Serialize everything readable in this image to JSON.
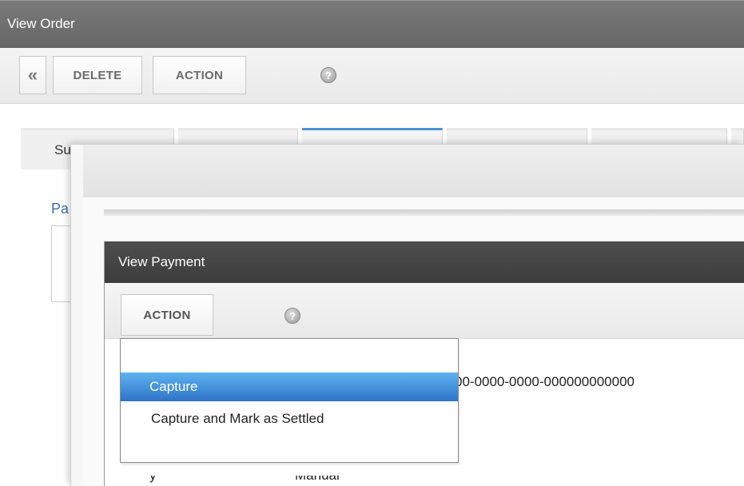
{
  "window": {
    "title": "View Order"
  },
  "toolbar": {
    "back_glyph": "«",
    "delete_label": "DELETE",
    "action_label": "ACTION",
    "help_glyph": "?"
  },
  "tabs": [
    {
      "label": "Su"
    },
    {
      "label": ""
    },
    {
      "label": ""
    },
    {
      "label": ""
    },
    {
      "label": ""
    },
    {
      "label": ""
    }
  ],
  "section": {
    "title": "Pa"
  },
  "payment": {
    "title": "View Payment",
    "action_label": "ACTION",
    "help_glyph": "?",
    "visible_value": "00-0000-0000-000000000000",
    "peek_left": "y",
    "peek_right": "Manual"
  },
  "dropdown": {
    "items": [
      {
        "label": "Capture",
        "selected": true
      },
      {
        "label": "Capture and Mark as Settled",
        "selected": false
      }
    ]
  },
  "colors": {
    "accent": "#4b93d6",
    "selection": "#3b82d0",
    "title_bar": "#6e6e6e",
    "payment_title_bar": "#454545"
  },
  "icons": {
    "back": "chevron-double-left-icon",
    "help": "help-icon"
  }
}
